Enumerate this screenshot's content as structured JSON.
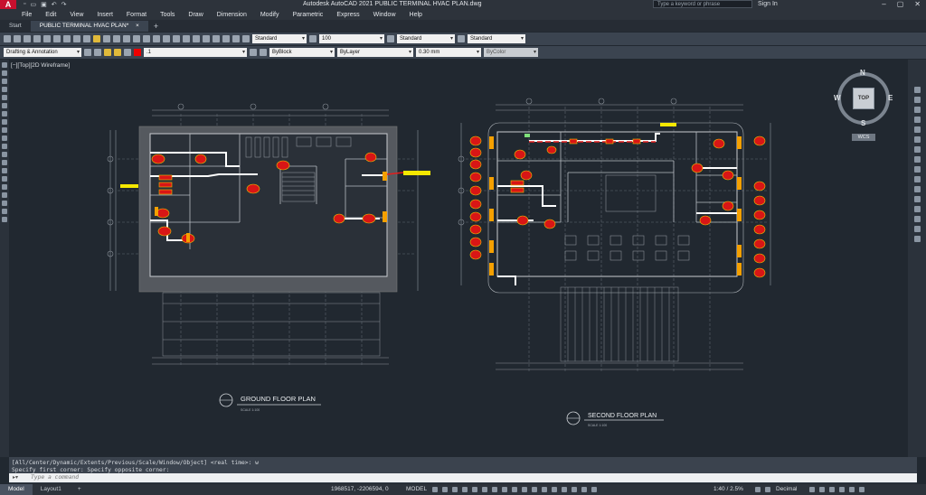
{
  "titlebar": {
    "logo": "A",
    "title": "Autodesk AutoCAD 2021   PUBLIC TERMINAL HVAC PLAN.dwg",
    "search_placeholder": "Type a keyword or phrase",
    "signin": "Sign In",
    "minimize": "–",
    "maximize": "▢",
    "close": "✕"
  },
  "menubar": {
    "items": [
      "File",
      "Edit",
      "View",
      "Insert",
      "Format",
      "Tools",
      "Draw",
      "Dimension",
      "Modify",
      "Parametric",
      "Express",
      "Window",
      "Help"
    ]
  },
  "doc_tabs": {
    "start": "Start",
    "active": "PUBLIC TERMINAL HVAC PLAN*",
    "close": "×",
    "add": "+"
  },
  "toolbar1": {
    "text_style": "Standard",
    "text_height": "100",
    "dim_style": "Standard",
    "table_style": "Standard"
  },
  "toolbar2": {
    "workspace": "Drafting & Annotation",
    "layer": ".1",
    "color": "ByBlock",
    "linetype": "ByLayer",
    "lineweight": "0.30 mm",
    "plotstyle": "ByColor"
  },
  "canvas": {
    "viewport_label": "[−][Top][2D Wireframe]"
  },
  "drawing": {
    "ground_title": "GROUND FLOOR PLAN",
    "second_title": "SECOND FLOOR PLAN",
    "ground_sub": "SCALE 1:100",
    "second_sub": "SCALE 1:100"
  },
  "viewcube": {
    "n": "N",
    "s": "S",
    "e": "E",
    "w": "W",
    "face": "TOP",
    "wcs": "WCS"
  },
  "commandline": {
    "line1": "[All/Center/Dynamic/Extents/Previous/Scale/Window/Object] <real time>: w",
    "line2": "Specify first corner: Specify opposite corner:",
    "placeholder": "Type a command"
  },
  "statusbar": {
    "model_tab": "Model",
    "layout_tab": "Layout1",
    "add": "+",
    "coords": "1968517, -2206594, 0",
    "model_space": "MODEL",
    "scale": "1:40 / 2.5%",
    "units": "Decimal"
  },
  "colors": {
    "canvas": "#212830",
    "duct": "#ffffff",
    "equipment": "#e21c1c",
    "highlight": "#f5e800"
  }
}
